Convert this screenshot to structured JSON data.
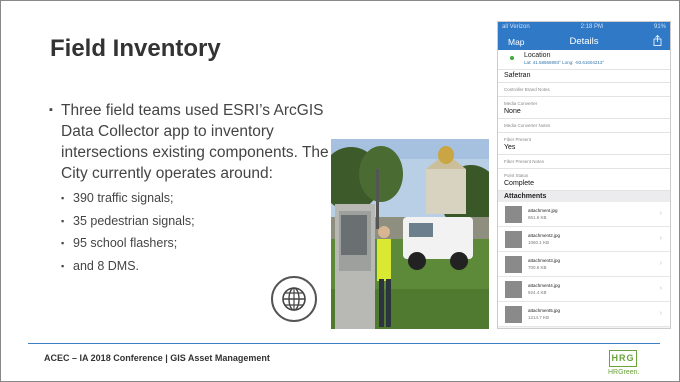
{
  "slide": {
    "title": "Field Inventory",
    "bullet_main": "Three field teams used ESRI’s ArcGIS Data Collector app to inventory intersections existing components. The City currently operates around:",
    "sub_bullets": [
      "390 traffic signals;",
      "35 pedestrian signals;",
      "95 school flashers;",
      "and 8 DMS."
    ],
    "bullet_glyph": "▪"
  },
  "phone": {
    "status": {
      "carrier": "all Verizon",
      "time": "2:18 PM",
      "battery": "91%"
    },
    "nav": {
      "back": "Map",
      "title": "Details"
    },
    "location": {
      "label": "Location",
      "coords": "Lat: 41.58566993° Long: -93.61604213°"
    },
    "fields": [
      {
        "label": "",
        "value": "Safetran"
      },
      {
        "label": "Controller Brand Notes",
        "value": ""
      },
      {
        "label": "Media Converter",
        "value": "None"
      },
      {
        "label": "Media Converter Notes",
        "value": ""
      },
      {
        "label": "Fiber Present",
        "value": "Yes"
      },
      {
        "label": "Fiber Present Notes",
        "value": ""
      },
      {
        "label": "Point Status",
        "value": "Complete"
      }
    ],
    "attachments_header": "Attachments",
    "attachments": [
      {
        "name": "attachment.jpg",
        "size": "861.6 KB"
      },
      {
        "name": "attachment2.jpg",
        "size": "1060.1 KB"
      },
      {
        "name": "attachment3.jpg",
        "size": "700.6 KB"
      },
      {
        "name": "attachment4.jpg",
        "size": "924.4 KB"
      },
      {
        "name": "attachment5.jpg",
        "size": "1214.7 KB"
      }
    ]
  },
  "footer": {
    "text": "ACEC – IA 2018 Conference |  GIS Asset Management"
  },
  "logo": {
    "mark": "HRG",
    "text": "HRGreen."
  },
  "colors": {
    "accent_line": "#3c7fc2",
    "ios_blue": "#2f79c7",
    "logo_green": "#6aa33a"
  },
  "icons": {
    "globe": "globe-icon",
    "share": "share-icon",
    "location": "location-pin-icon",
    "chevron": "chevron-right-icon"
  }
}
